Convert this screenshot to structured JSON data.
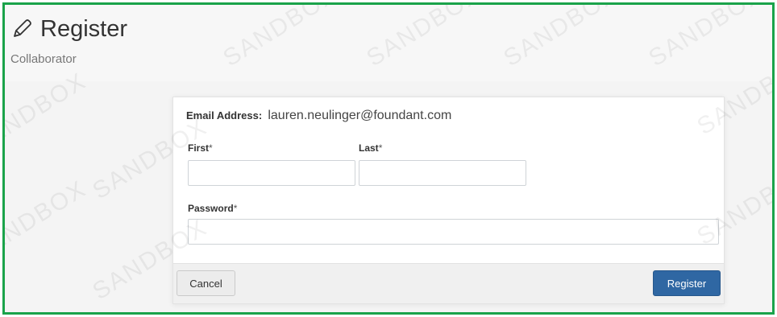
{
  "header": {
    "title": "Register",
    "subtitle": "Collaborator"
  },
  "watermark": {
    "text_a": "SANDBOX",
    "text_b": "SANDBOX"
  },
  "form": {
    "email_label": "Email Address:",
    "email_value": "lauren.neulinger@foundant.com",
    "first_label": "First",
    "last_label": "Last",
    "password_label": "Password",
    "required_marker": "*",
    "first_value": "",
    "last_value": "",
    "password_value": ""
  },
  "footer": {
    "cancel_label": "Cancel",
    "register_label": "Register"
  },
  "colors": {
    "frame_border": "#1aa34a",
    "primary_button": "#2f67a3"
  },
  "icons": {
    "title_icon": "pencil-icon"
  }
}
